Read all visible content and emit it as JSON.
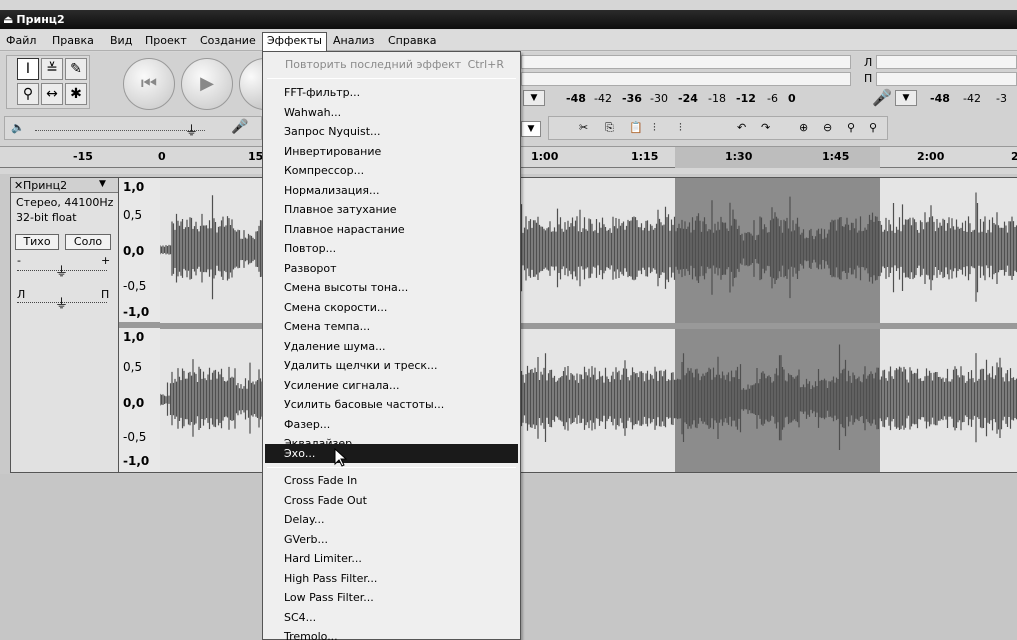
{
  "window": {
    "title": "Принц2"
  },
  "menubar": {
    "items": [
      {
        "label": "Файл"
      },
      {
        "label": "Правка"
      },
      {
        "label": "Вид"
      },
      {
        "label": "Проект"
      },
      {
        "label": "Создание"
      },
      {
        "label": "Эффекты"
      },
      {
        "label": "Анализ"
      },
      {
        "label": "Справка"
      }
    ]
  },
  "effects_menu": {
    "repeat_last": "Повторить последний эффект",
    "repeat_shortcut": "Ctrl+R",
    "builtin": [
      "FFT-фильтр...",
      "Wahwah...",
      "Запрос Nyquist...",
      "Инвертирование",
      "Компрессор...",
      "Нормализация...",
      "Плавное затухание",
      "Плавное нарастание",
      "Повтор...",
      "Разворот",
      "Смена высоты тона...",
      "Смена скорости...",
      "Смена темпа...",
      "Удаление шума...",
      "Удалить щелчки и треск...",
      "Усиление сигнала...",
      "Усилить басовые частоты...",
      "Фазер...",
      "Эквалайзер..."
    ],
    "highlighted": "Эхо...",
    "plugins": [
      "Cross Fade In",
      "Cross Fade Out",
      "Delay...",
      "GVerb...",
      "Hard Limiter...",
      "High Pass Filter...",
      "Low Pass Filter...",
      "SC4...",
      "Tremolo..."
    ]
  },
  "meters": {
    "playback": [
      "-48",
      "-42",
      "-36",
      "-30",
      "-24",
      "-18",
      "-12",
      "-6",
      "0"
    ],
    "record": [
      "-48",
      "-42",
      "-3"
    ],
    "lr_top": "Л",
    "lr_bottom": "П"
  },
  "ruler": {
    "ticks": [
      "-15",
      "0",
      "15",
      "1:00",
      "1:15",
      "1:30",
      "1:45",
      "2:00",
      "2"
    ]
  },
  "track": {
    "name": "Принц2",
    "info_line1": "Стерео, 44100Hz",
    "info_line2": "32-bit float",
    "mute": "Тихо",
    "solo": "Соло",
    "gain_minus": "-",
    "gain_plus": "+",
    "pan_left": "Л",
    "pan_right": "П",
    "scale": [
      "1,0",
      "0,5",
      "0,0",
      "-0,5",
      "-1,0",
      "1,0",
      "0,5",
      "0,0",
      "-0,5",
      "-1,0"
    ]
  },
  "colors": {
    "titlebar": "#111111",
    "highlight": "#1a1a1a",
    "waveform": "#4f4f4f",
    "selection": "#8c8c8c"
  }
}
